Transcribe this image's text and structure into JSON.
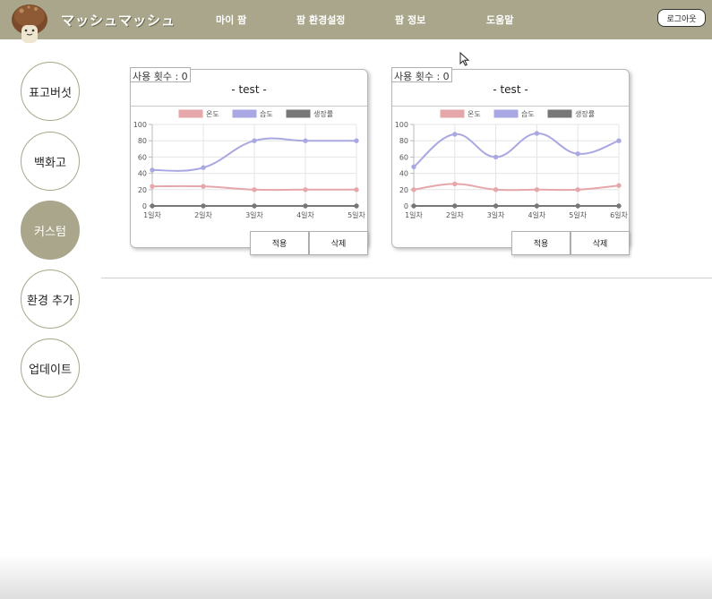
{
  "header": {
    "brand": "マッシュマッシュ",
    "nav": [
      "마이 팜",
      "팜 환경설정",
      "팜 정보",
      "도움말"
    ],
    "logout_label": "로그아웃",
    "colors": {
      "bar": "#a9a68b"
    }
  },
  "sidebar": {
    "items": [
      {
        "label": "표고버섯",
        "active": false
      },
      {
        "label": "백화고",
        "active": false
      },
      {
        "label": "커스텀",
        "active": true
      },
      {
        "label": "환경 추가",
        "active": false
      },
      {
        "label": "업데이트",
        "active": false
      }
    ]
  },
  "cards": [
    {
      "usage": "사용 횟수 : 0",
      "title": "- test -",
      "apply_label": "적용",
      "delete_label": "삭제"
    },
    {
      "usage": "사용 횟수 : 0",
      "title": "- test -",
      "apply_label": "적용",
      "delete_label": "삭제"
    }
  ],
  "chart_data": [
    {
      "type": "line",
      "categories": [
        "1일차",
        "2일차",
        "3일차",
        "4일차",
        "5일차"
      ],
      "series": [
        {
          "name": "온도",
          "color": "#e5a7a9",
          "values": [
            24,
            24,
            20,
            20,
            20
          ]
        },
        {
          "name": "습도",
          "color": "#a9a8e2",
          "values": [
            44,
            47,
            80,
            80,
            80
          ]
        },
        {
          "name": "생장률",
          "color": "#777777",
          "values": [
            0,
            0,
            0,
            0,
            0
          ]
        }
      ],
      "yticks": [
        0,
        20,
        40,
        60,
        80,
        100
      ],
      "ylim": [
        0,
        100
      ],
      "grid": true,
      "legend": "top"
    },
    {
      "type": "line",
      "categories": [
        "1일차",
        "2일차",
        "3일차",
        "4일차",
        "5일차",
        "6일차"
      ],
      "series": [
        {
          "name": "온도",
          "color": "#e5a7a9",
          "values": [
            20,
            27,
            20,
            20,
            20,
            25
          ]
        },
        {
          "name": "습도",
          "color": "#a9a8e2",
          "values": [
            48,
            88,
            60,
            89,
            64,
            80
          ]
        },
        {
          "name": "생장률",
          "color": "#777777",
          "values": [
            0,
            0,
            0,
            0,
            0,
            0
          ]
        }
      ],
      "yticks": [
        0,
        20,
        40,
        60,
        80,
        100
      ],
      "ylim": [
        0,
        100
      ],
      "grid": true,
      "legend": "top"
    }
  ]
}
